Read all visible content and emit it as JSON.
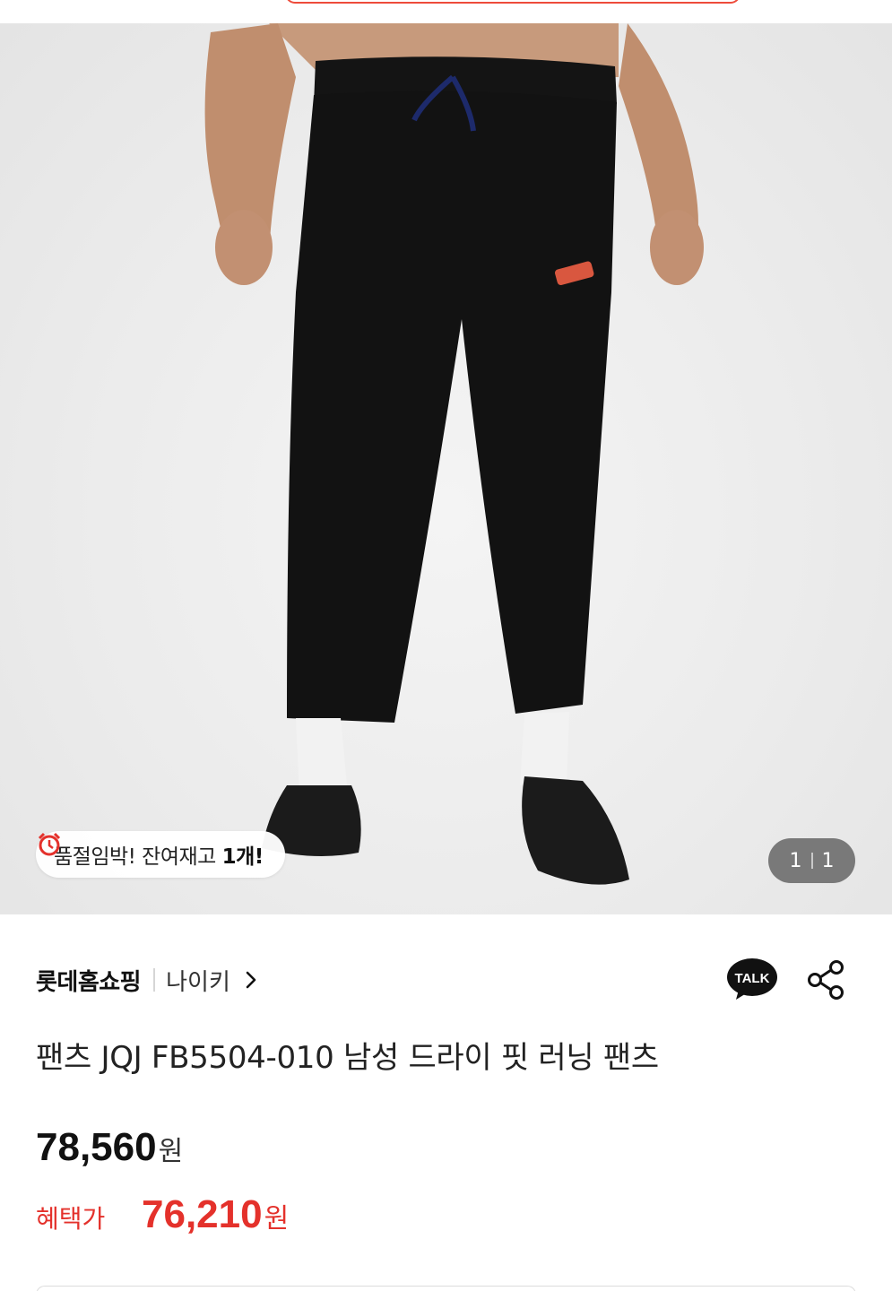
{
  "product_image": {
    "alt_icon": "product-photo"
  },
  "stock_badge": {
    "prefix": "품절임박! 잔여재고 ",
    "count": "1개!"
  },
  "gallery": {
    "current": "1",
    "total": "1"
  },
  "seller": {
    "store": "롯데홈쇼핑",
    "brand": "나이키"
  },
  "actions": {
    "talk_label": "TALK"
  },
  "product": {
    "title": "팬츠 JQJ FB5504-010 남성 드라이 핏 러닝 팬츠"
  },
  "pricing": {
    "price": "78,560",
    "currency": "원",
    "benefit_label": "혜택가",
    "benefit_price": "76,210",
    "benefit_currency": "원"
  },
  "colors": {
    "accent": "#e4312b",
    "text": "#111111"
  }
}
